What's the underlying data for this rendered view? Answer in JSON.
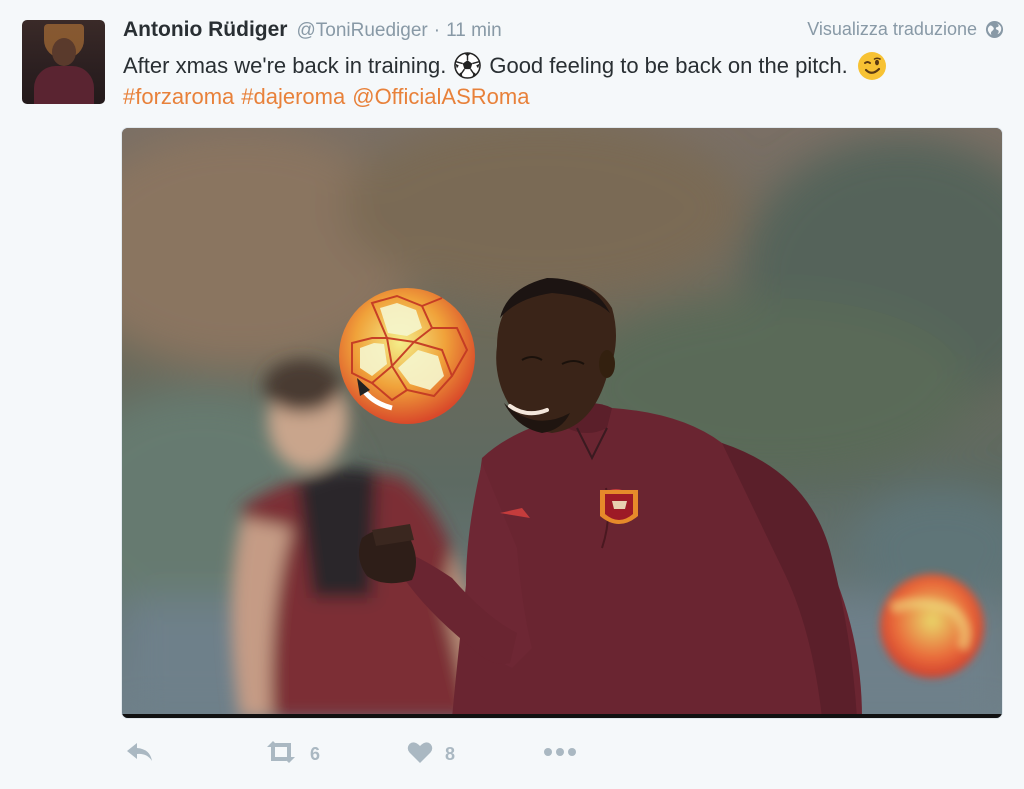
{
  "author": {
    "name": "Antonio Rüdiger",
    "handle": "@ToniRuediger",
    "separator": "·",
    "time": "11 min"
  },
  "translate_label": "Visualizza traduzione",
  "tweet": {
    "line1_before": "After xmas we're back in training.",
    "line1_after": "Good feeling to be back on the pitch.",
    "hashtags": [
      "#forzaroma",
      "#dajeroma",
      "@OfficialASRoma"
    ]
  },
  "icons": {
    "globe": "globe-icon",
    "soccer_ball": "soccer-ball-emoji",
    "wink": "winking-face-emoji",
    "reply": "reply-icon",
    "retweet": "retweet-icon",
    "like": "heart-icon",
    "more": "more-icon"
  },
  "actions": {
    "retweet_count": "6",
    "like_count": "8"
  },
  "colors": {
    "link": "#e8813a",
    "text": "#292f33",
    "muted": "#8899a6",
    "icon": "#aab8c2",
    "background": "#f5f8fa"
  }
}
